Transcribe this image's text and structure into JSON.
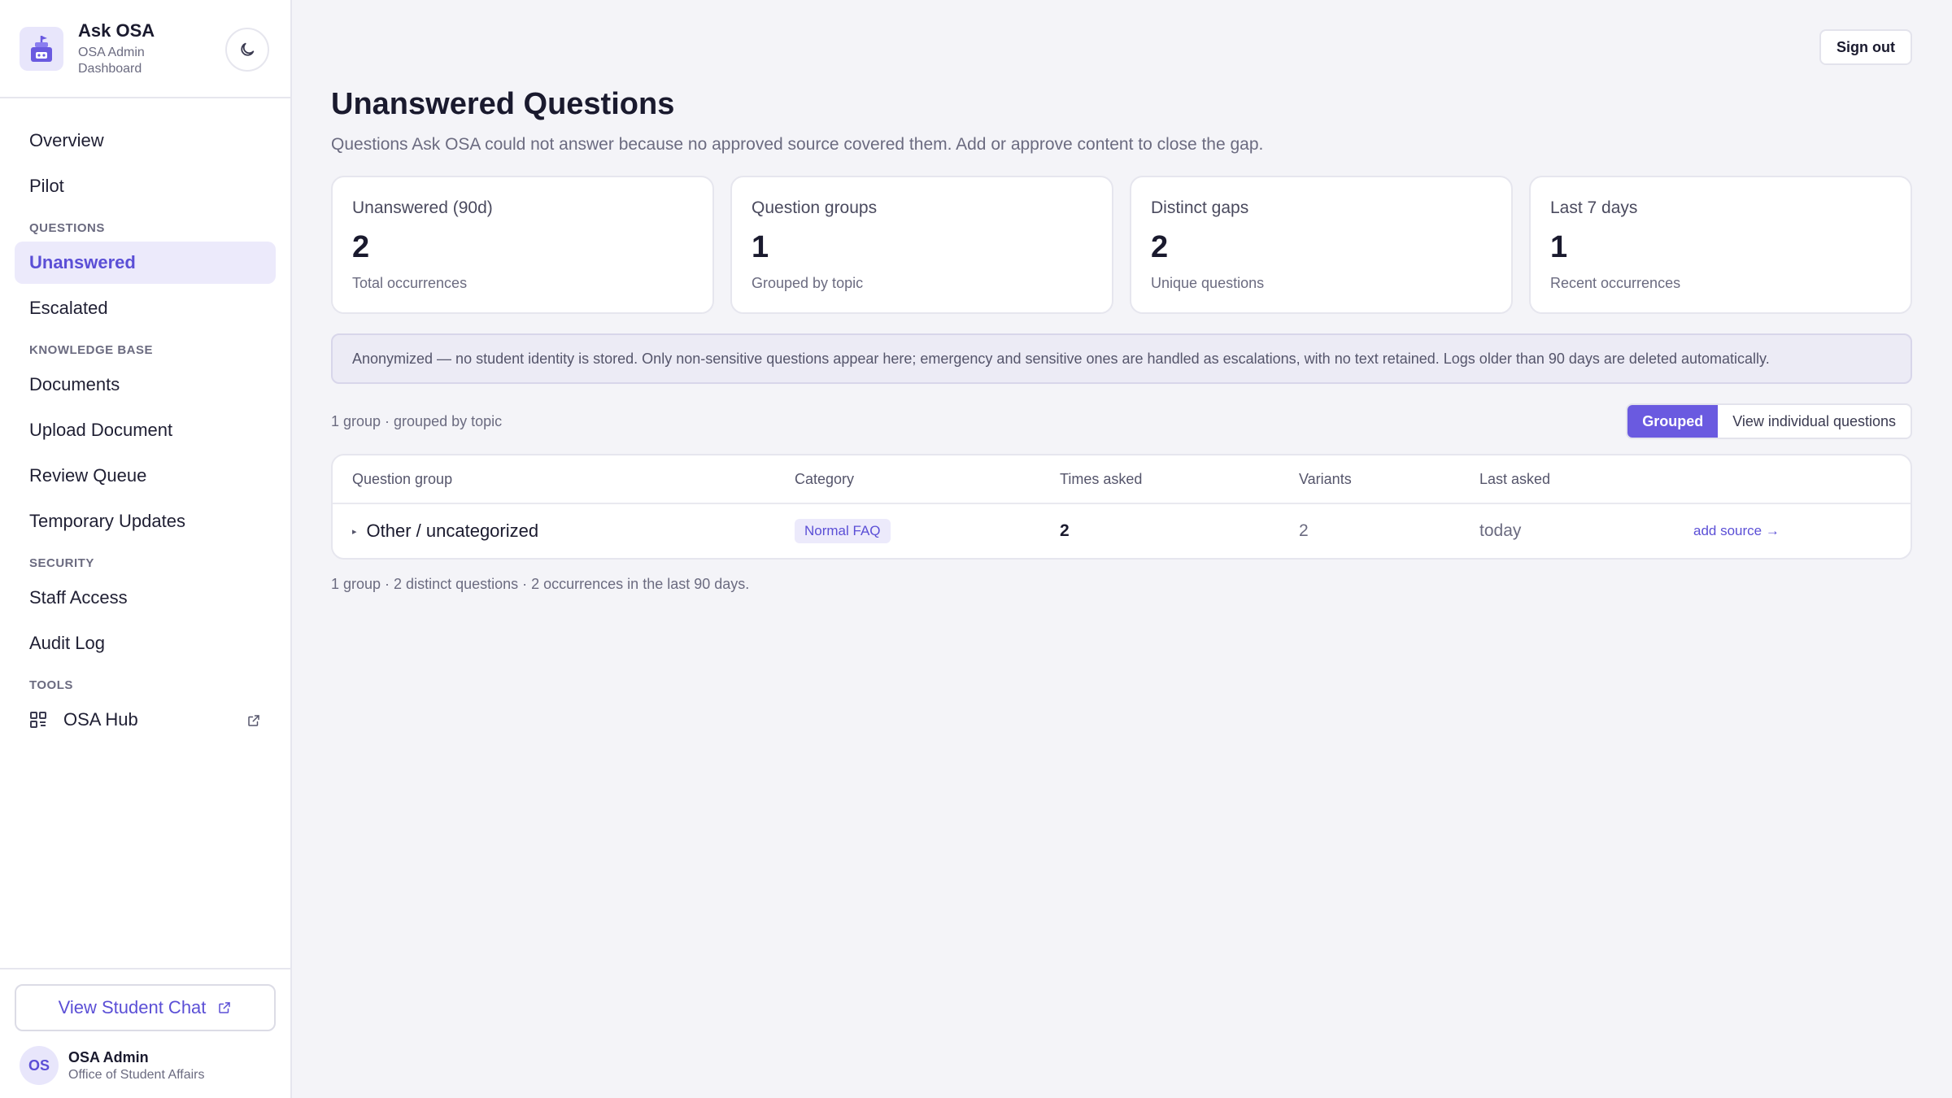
{
  "brand": {
    "title": "Ask OSA",
    "subtitle": "OSA Admin Dashboard",
    "logo_icon": "robot-icon",
    "theme_toggle_icon": "moon-icon"
  },
  "nav": {
    "top": [
      "Overview",
      "Pilot"
    ],
    "sections": {
      "questions": "QUESTIONS",
      "knowledge": "KNOWLEDGE BASE",
      "security": "SECURITY",
      "tools": "TOOLS"
    },
    "questions": [
      "Unanswered",
      "Escalated"
    ],
    "knowledge": [
      "Documents",
      "Upload Document",
      "Review Queue",
      "Temporary Updates"
    ],
    "security": [
      "Staff Access",
      "Audit Log"
    ],
    "tools": [
      "OSA Hub"
    ],
    "active": "Unanswered"
  },
  "footer": {
    "student_chat_label": "View Student Chat",
    "avatar_initials": "OS",
    "user_name": "OSA Admin",
    "user_org": "Office of Student Affairs"
  },
  "header": {
    "sign_out_label": "Sign out",
    "title": "Unanswered Questions",
    "description": "Questions Ask OSA could not answer because no approved source covered them. Add or approve content to close the gap."
  },
  "stats": [
    {
      "label": "Unanswered (90d)",
      "value": "2",
      "sub": "Total occurrences"
    },
    {
      "label": "Question groups",
      "value": "1",
      "sub": "Grouped by topic"
    },
    {
      "label": "Distinct gaps",
      "value": "2",
      "sub": "Unique questions"
    },
    {
      "label": "Last 7 days",
      "value": "1",
      "sub": "Recent occurrences"
    }
  ],
  "notice": "Anonymized — no student identity is stored. Only non-sensitive questions appear here; emergency and sensitive ones are handled as escalations, with no text retained. Logs older than 90 days are deleted automatically.",
  "toolbar": {
    "summary": "1 group · grouped by topic",
    "view_grouped": "Grouped",
    "view_individual": "View individual questions",
    "active_view": "Grouped"
  },
  "table": {
    "columns": [
      "Question group",
      "Category",
      "Times asked",
      "Variants",
      "Last asked"
    ],
    "rows": [
      {
        "group": "Other / uncategorized",
        "category": "Normal FAQ",
        "times_asked": "2",
        "variants": "2",
        "last_asked": "today",
        "action": "add source →"
      }
    ],
    "footer": "1 group · 2 distinct questions · 2 occurrences in the last 90 days."
  },
  "colors": {
    "accent": "#6a5ae0",
    "accent_text": "#5b4fd6",
    "accent_bg": "#eceafb",
    "page_bg": "#f4f4f8"
  }
}
